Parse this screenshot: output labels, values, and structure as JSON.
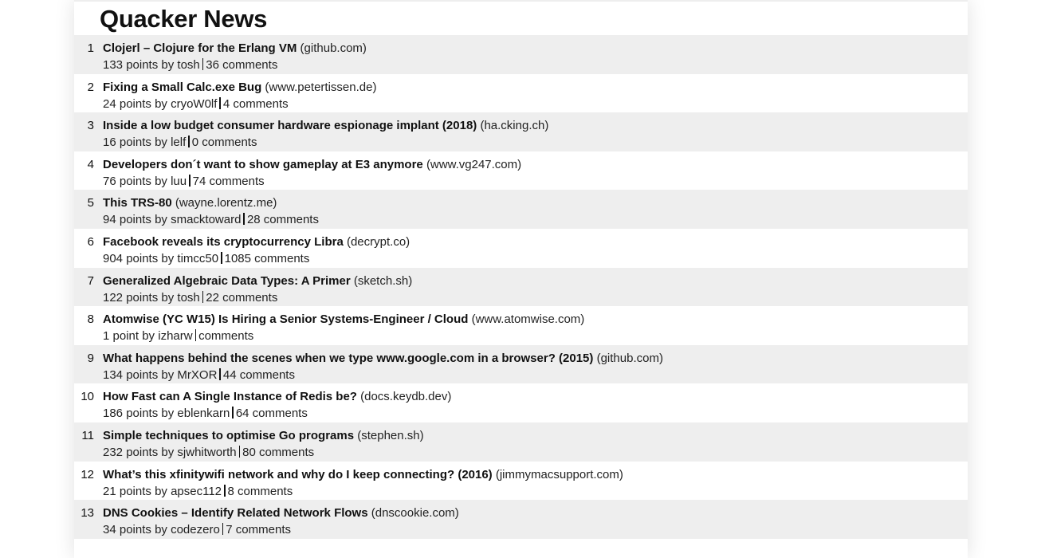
{
  "site_title": "Quacker News",
  "stories": [
    {
      "rank": "1",
      "title": "Clojerl – Clojure for the Erlang VM",
      "domain": "(github.com)",
      "points": "133 points",
      "by": "by",
      "user": "tosh",
      "comments": "36 comments"
    },
    {
      "rank": "2",
      "title": "Fixing a Small Calc.exe Bug",
      "domain": "(www.petertissen.de)",
      "points": "24 points",
      "by": "by",
      "user": "cryoW0lf",
      "comments": "4 comments"
    },
    {
      "rank": "3",
      "title": "Inside a low budget consumer hardware espionage implant (2018)",
      "domain": "(ha.cking.ch)",
      "points": "16 points",
      "by": "by",
      "user": "lelf",
      "comments": "0 comments"
    },
    {
      "rank": "4",
      "title": "Developers don´t want to show gameplay at E3 anymore",
      "domain": "(www.vg247.com)",
      "points": "76 points",
      "by": "by",
      "user": "luu",
      "comments": "74 comments"
    },
    {
      "rank": "5",
      "title": "This TRS-80",
      "domain": "(wayne.lorentz.me)",
      "points": "94 points",
      "by": "by",
      "user": "smacktoward",
      "comments": "28 comments"
    },
    {
      "rank": "6",
      "title": "Facebook reveals its cryptocurrency Libra",
      "domain": "(decrypt.co)",
      "points": "904 points",
      "by": "by",
      "user": "timcc50",
      "comments": "1085 comments"
    },
    {
      "rank": "7",
      "title": "Generalized Algebraic Data Types: A Primer",
      "domain": "(sketch.sh)",
      "points": "122 points",
      "by": "by",
      "user": "tosh",
      "comments": "22 comments"
    },
    {
      "rank": "8",
      "title": "Atomwise (YC W15) Is Hiring a Senior Systems-Engineer / Cloud",
      "domain": "(www.atomwise.com)",
      "points": "1 point",
      "by": "by",
      "user": "izharw",
      "comments": "comments"
    },
    {
      "rank": "9",
      "title": "What happens behind the scenes when we type www.google.com in a browser? (2015)",
      "domain": "(github.com)",
      "points": "134 points",
      "by": "by",
      "user": "MrXOR",
      "comments": "44 comments"
    },
    {
      "rank": "10",
      "title": "How Fast can A Single Instance of Redis be?",
      "domain": "(docs.keydb.dev)",
      "points": "186 points",
      "by": "by",
      "user": "eblenkarn",
      "comments": "64 comments"
    },
    {
      "rank": "11",
      "title": "Simple techniques to optimise Go programs",
      "domain": "(stephen.sh)",
      "points": "232 points",
      "by": "by",
      "user": "sjwhitworth",
      "comments": "80 comments"
    },
    {
      "rank": "12",
      "title": "What’s this xfinitywifi network and why do I keep connecting? (2016)",
      "domain": "(jimmymacsupport.com)",
      "points": "21 points",
      "by": "by",
      "user": "apsec112",
      "comments": "8 comments"
    },
    {
      "rank": "13",
      "title": "DNS Cookies – Identify Related Network Flows",
      "domain": "(dnscookie.com)",
      "points": "34 points",
      "by": "by",
      "user": "codezero",
      "comments": "7 comments"
    }
  ]
}
